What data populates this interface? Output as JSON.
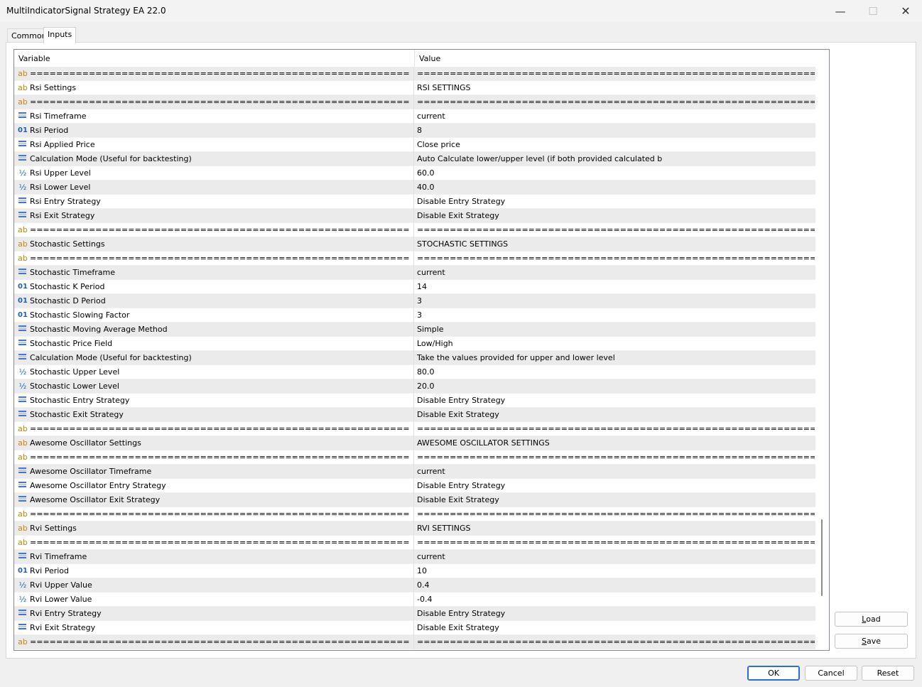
{
  "window": {
    "title": "MultiIndicatorSignal Strategy EA 22.0",
    "minimize": "—",
    "maximize": "☐",
    "close": "✕"
  },
  "tabs": [
    {
      "label": "Common",
      "active": false
    },
    {
      "label": "Inputs",
      "active": true
    }
  ],
  "table": {
    "headers": {
      "variable": "Variable",
      "value": "Value"
    },
    "rows": [
      {
        "type": "ab",
        "var": "=================================================================",
        "val": "================================================================="
      },
      {
        "type": "ab",
        "var": "Rsi Settings",
        "val": "RSI SETTINGS"
      },
      {
        "type": "ab",
        "var": "=================================================================",
        "val": "================================================================="
      },
      {
        "type": "enum",
        "var": "Rsi Timeframe",
        "val": "current"
      },
      {
        "type": "num",
        "var": "Rsi Period",
        "val": "8"
      },
      {
        "type": "enum",
        "var": "Rsi Applied Price",
        "val": "Close price"
      },
      {
        "type": "enum",
        "var": "Calculation Mode (Useful for backtesting)",
        "val": "Auto Calculate lower/upper level (if both provided calculated b"
      },
      {
        "type": "frac",
        "var": "Rsi Upper Level",
        "val": "60.0"
      },
      {
        "type": "frac",
        "var": "Rsi Lower Level",
        "val": "40.0"
      },
      {
        "type": "enum",
        "var": "Rsi Entry Strategy",
        "val": "Disable Entry Strategy"
      },
      {
        "type": "enum",
        "var": "Rsi Exit Strategy",
        "val": "Disable Exit Strategy"
      },
      {
        "type": "ab",
        "var": "=================================================================",
        "val": "================================================================="
      },
      {
        "type": "ab",
        "var": "Stochastic Settings",
        "val": "STOCHASTIC SETTINGS"
      },
      {
        "type": "ab",
        "var": "=================================================================",
        "val": "================================================================="
      },
      {
        "type": "enum",
        "var": "Stochastic Timeframe",
        "val": "current"
      },
      {
        "type": "num",
        "var": "Stochastic K Period",
        "val": "14"
      },
      {
        "type": "num",
        "var": "Stochastic D Period",
        "val": "3"
      },
      {
        "type": "num",
        "var": "Stochastic Slowing Factor",
        "val": "3"
      },
      {
        "type": "enum",
        "var": "Stochastic Moving Average Method",
        "val": "Simple"
      },
      {
        "type": "enum",
        "var": "Stochastic Price Field",
        "val": "Low/High"
      },
      {
        "type": "enum",
        "var": "Calculation Mode (Useful for backtesting)",
        "val": "Take the values provided for upper and lower level"
      },
      {
        "type": "frac",
        "var": "Stochastic Upper Level",
        "val": "80.0"
      },
      {
        "type": "frac",
        "var": "Stochastic Lower Level",
        "val": "20.0"
      },
      {
        "type": "enum",
        "var": "Stochastic Entry Strategy",
        "val": "Disable Entry Strategy"
      },
      {
        "type": "enum",
        "var": "Stochastic Exit Strategy",
        "val": "Disable Exit Strategy"
      },
      {
        "type": "ab",
        "var": "=================================================================",
        "val": "================================================================="
      },
      {
        "type": "ab",
        "var": "Awesome Oscillator Settings",
        "val": "AWESOME OSCILLATOR SETTINGS"
      },
      {
        "type": "ab",
        "var": "=================================================================",
        "val": "================================================================="
      },
      {
        "type": "enum",
        "var": "Awesome Oscillator Timeframe",
        "val": "current"
      },
      {
        "type": "enum",
        "var": "Awesome Oscillator Entry Strategy",
        "val": "Disable Entry Strategy"
      },
      {
        "type": "enum",
        "var": "Awesome Oscillator Exit Strategy",
        "val": "Disable Exit Strategy"
      },
      {
        "type": "ab",
        "var": "=================================================================",
        "val": "================================================================="
      },
      {
        "type": "ab",
        "var": "Rvi Settings",
        "val": "RVI SETTINGS"
      },
      {
        "type": "ab",
        "var": "=================================================================",
        "val": "================================================================="
      },
      {
        "type": "enum",
        "var": "Rvi Timeframe",
        "val": "current"
      },
      {
        "type": "num",
        "var": "Rvi Period",
        "val": "10"
      },
      {
        "type": "frac",
        "var": "Rvi Upper Value",
        "val": "0.4"
      },
      {
        "type": "frac",
        "var": "Rvi Lower Value",
        "val": "-0.4"
      },
      {
        "type": "enum",
        "var": "Rvi Entry Strategy",
        "val": "Disable Entry Strategy"
      },
      {
        "type": "enum",
        "var": "Rvi Exit Strategy",
        "val": "Disable Exit Strategy"
      },
      {
        "type": "ab",
        "var": "=================================================================",
        "val": "================================================================="
      }
    ]
  },
  "icons": {
    "ab": "ab",
    "num": "01",
    "frac": "½"
  },
  "buttons": {
    "load_pre": "",
    "load_u": "L",
    "load_post": "oad",
    "save_pre": "",
    "save_u": "S",
    "save_post": "ave",
    "ok": "OK",
    "cancel": "Cancel",
    "reset": "Reset"
  }
}
